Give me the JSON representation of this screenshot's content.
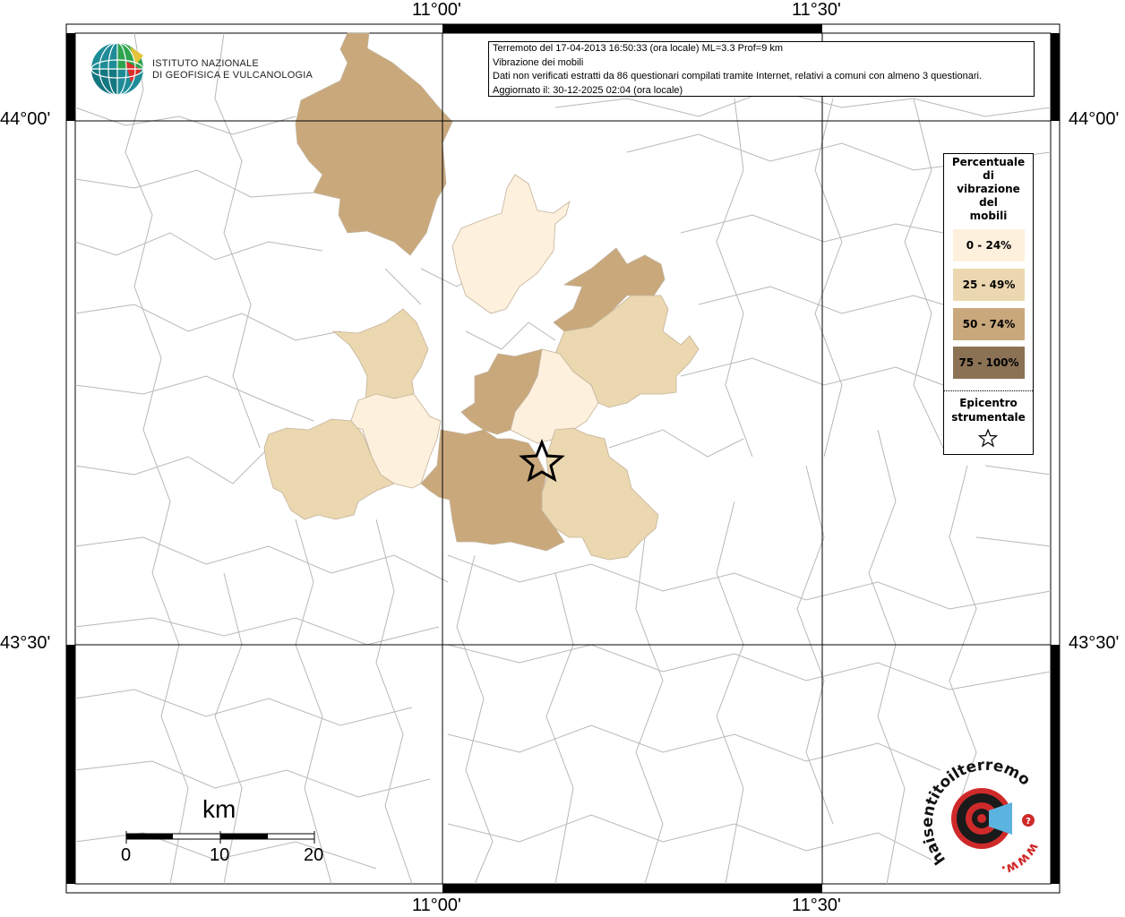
{
  "frame": {
    "top_ticks": [
      "11°00'",
      "11°30'"
    ],
    "bottom_ticks": [
      "11°00'",
      "11°30'"
    ],
    "left_ticks": [
      "44°00'",
      "43°30'"
    ],
    "right_ticks": [
      "44°00'",
      "43°30'"
    ]
  },
  "logo": {
    "line1": "ISTITUTO NAZIONALE",
    "line2": "DI GEOFISICA E VULCANOLOGIA"
  },
  "info": {
    "line1": "Terremoto del 17-04-2013 16:50:33 (ora locale) ML=3.3 Prof=9 km",
    "line2": "Vibrazione dei mobili",
    "line3": "Dati non verificati estratti da 86 questionari compilati tramite Internet, relativi a comuni con almeno 3 questionari.",
    "line4": "Aggiornato il: 30-12-2025 02:04 (ora locale)"
  },
  "legend": {
    "title_lines": [
      "Percentuale",
      "di",
      "vibrazione",
      "del",
      "mobili"
    ],
    "items": [
      {
        "label": "0 - 24%",
        "color": "#fdf0dc"
      },
      {
        "label": "25 - 49%",
        "color": "#ebd8b0"
      },
      {
        "label": "50 - 74%",
        "color": "#c9a87c"
      },
      {
        "label": "75 - 100%",
        "color": "#8b7255"
      }
    ],
    "epicenter_lines": [
      "Epicentro",
      "strumentale"
    ]
  },
  "scalebar": {
    "unit": "km",
    "labels": [
      "0",
      "10",
      "20"
    ]
  },
  "watermark": {
    "text1": "haisentitoilterremoto.it",
    "text2": "www."
  },
  "colors": {
    "class0": "#fdf0dc",
    "class1": "#ebd8b0",
    "class2": "#c9a87c",
    "class3": "#8b7255",
    "border": "#b8b8b8"
  }
}
